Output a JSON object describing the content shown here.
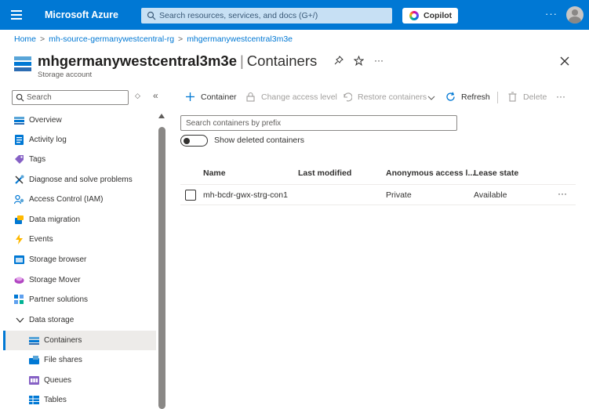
{
  "topbar": {
    "brand": "Microsoft Azure",
    "search_placeholder": "Search resources, services, and docs (G+/)",
    "copilot_label": "Copilot",
    "more": "···"
  },
  "breadcrumb": [
    "Home",
    "mh-source-germanywestcentral-rg",
    "mhgermanywestcentral3m3e"
  ],
  "header": {
    "resource_name": "mhgermanywestcentral3m3e",
    "separator": "|",
    "section": "Containers",
    "subtitle": "Storage account",
    "more": "···"
  },
  "sidebar": {
    "search_placeholder": "Search",
    "items": [
      {
        "label": "Overview",
        "icon": "overview-icon"
      },
      {
        "label": "Activity log",
        "icon": "activity-log-icon"
      },
      {
        "label": "Tags",
        "icon": "tag-icon"
      },
      {
        "label": "Diagnose and solve problems",
        "icon": "wrench-icon"
      },
      {
        "label": "Access Control (IAM)",
        "icon": "people-icon"
      },
      {
        "label": "Data migration",
        "icon": "migration-icon"
      },
      {
        "label": "Events",
        "icon": "lightning-icon"
      },
      {
        "label": "Storage browser",
        "icon": "storage-browser-icon"
      },
      {
        "label": "Storage Mover",
        "icon": "storage-mover-icon"
      },
      {
        "label": "Partner solutions",
        "icon": "partner-icon"
      },
      {
        "label": "Data storage",
        "icon": "chevron-down-icon"
      },
      {
        "label": "Containers",
        "icon": "containers-icon",
        "active": true
      },
      {
        "label": "File shares",
        "icon": "file-shares-icon"
      },
      {
        "label": "Queues",
        "icon": "queues-icon"
      },
      {
        "label": "Tables",
        "icon": "tables-icon"
      }
    ]
  },
  "commands": {
    "container": "Container",
    "change_access": "Change access level",
    "restore": "Restore containers",
    "refresh": "Refresh",
    "delete": "Delete",
    "more": "···"
  },
  "filter": {
    "placeholder": "Search containers by prefix"
  },
  "toggle": {
    "label": "Show deleted containers",
    "on": false
  },
  "table": {
    "columns": [
      "Name",
      "Last modified",
      "Anonymous access l...",
      "Lease state"
    ],
    "rows": [
      {
        "name": "mh-bcdr-gwx-strg-con1",
        "last_modified": "",
        "access": "Private",
        "lease": "Available",
        "more": "···"
      }
    ]
  },
  "colors": {
    "accent": "#0078d4",
    "search_bg": "#c7e0f4",
    "active_bg": "#edebe9"
  }
}
